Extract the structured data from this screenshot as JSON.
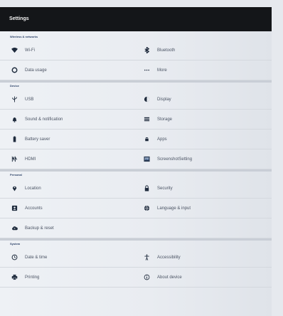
{
  "app": {
    "title": "Settings"
  },
  "sections": {
    "wireless": {
      "header": "Wireless & networks",
      "items": {
        "wifi": "Wi-Fi",
        "bluetooth": "Bluetooth",
        "data_usage": "Data usage",
        "more": "More"
      }
    },
    "device": {
      "header": "Device",
      "items": {
        "usb": "USB",
        "display": "Display",
        "sound": "Sound & notification",
        "storage": "Storage",
        "battery": "Battery saver",
        "apps": "Apps",
        "hdmi": "HDMI",
        "screenshot": "ScreenshotSetting"
      }
    },
    "personal": {
      "header": "Personal",
      "items": {
        "location": "Location",
        "security": "Security",
        "accounts": "Accounts",
        "language": "Language & input",
        "backup": "Backup & reset"
      }
    },
    "system": {
      "header": "System",
      "items": {
        "datetime": "Date & time",
        "accessibility": "Accessibility",
        "printing": "Printing",
        "about": "About device"
      }
    }
  },
  "icons": {
    "wifi": "wifi-icon",
    "bluetooth": "bluetooth-icon",
    "data_usage": "data-usage-icon",
    "more": "more-icon",
    "usb": "usb-icon",
    "display": "display-icon",
    "sound": "bell-icon",
    "storage": "storage-icon",
    "battery": "battery-icon",
    "apps": "android-icon",
    "hdmi": "hdmi-icon",
    "screenshot": "screenshot-icon",
    "location": "location-pin-icon",
    "security": "lock-icon",
    "accounts": "accounts-icon",
    "language": "globe-icon",
    "backup": "cloud-backup-icon",
    "datetime": "clock-icon",
    "accessibility": "accessibility-icon",
    "printing": "printer-icon",
    "about": "info-icon"
  },
  "colors": {
    "titlebar": "#141619",
    "header_text": "#2a3f66",
    "icon": "#1e2a3c"
  }
}
